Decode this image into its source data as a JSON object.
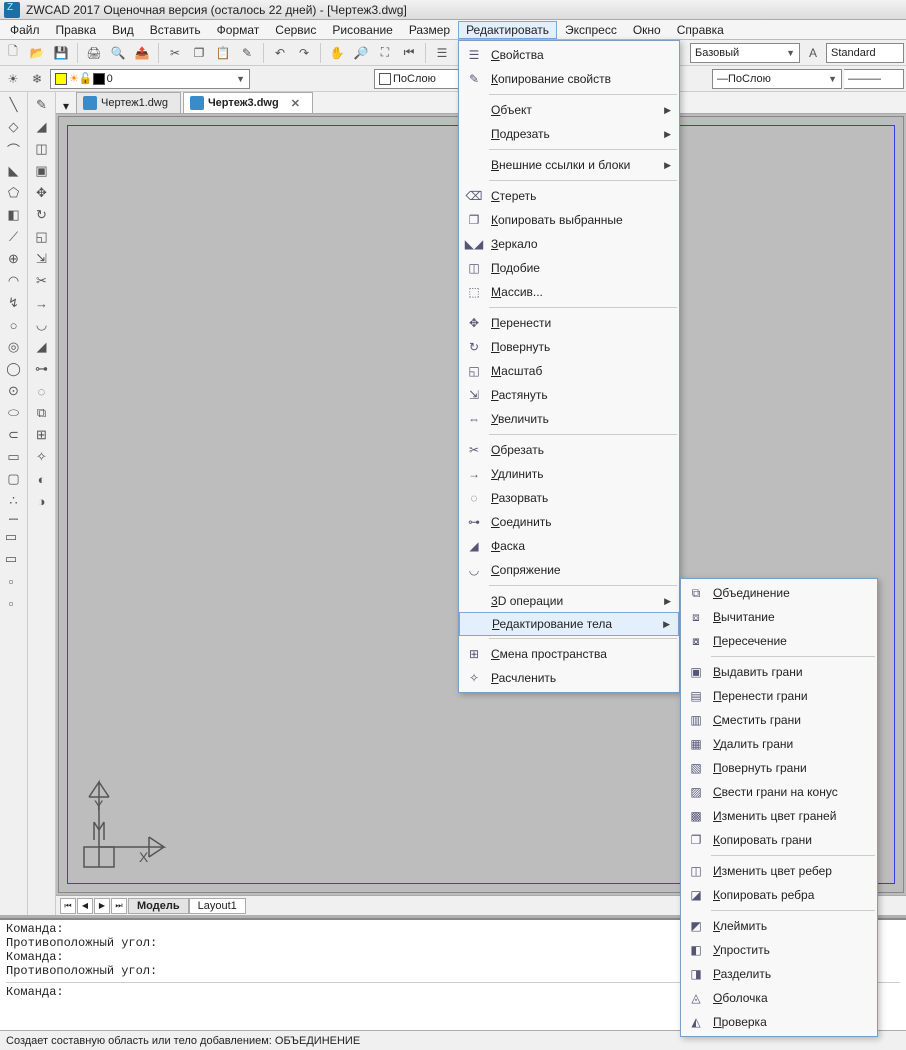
{
  "title": "ZWCAD 2017 Оценочная версия (осталось 22 дней) - [Чертеж3.dwg]",
  "menubar": [
    "Файл",
    "Правка",
    "Вид",
    "Вставить",
    "Формат",
    "Сервис",
    "Рисование",
    "Размер",
    "Редактировать",
    "Экспресс",
    "Окно",
    "Справка"
  ],
  "active_menu_index": 8,
  "layer_combo_prefix": "layer-state",
  "layer_value": "0",
  "bylayer1": "ПоСлою",
  "bylayer2": "ПоСлою",
  "base_style": "Базовый",
  "standard_style": "Standard",
  "doctabs": [
    {
      "label": "Чертеж1.dwg",
      "active": false
    },
    {
      "label": "Чертеж3.dwg",
      "active": true
    }
  ],
  "model_tabs": {
    "model": "Модель",
    "layout": "Layout1"
  },
  "cmd": {
    "l1": "Команда:",
    "l2": "Противоположный угол:",
    "l3": "Команда:",
    "l4": "Противоположный угол:",
    "prompt": "Команда:"
  },
  "status": "Создает составную область или тело добавлением:  ОБЪЕДИНЕНИЕ",
  "edit_menu": [
    {
      "t": "item",
      "label": "Свойства",
      "icon": "☰"
    },
    {
      "t": "item",
      "label": "Копирование свойств",
      "icon": "✎"
    },
    {
      "t": "sep"
    },
    {
      "t": "sub",
      "label": "Объект"
    },
    {
      "t": "sub",
      "label": "Подрезать"
    },
    {
      "t": "sep"
    },
    {
      "t": "sub",
      "label": "Внешние ссылки и блоки"
    },
    {
      "t": "sep"
    },
    {
      "t": "item",
      "label": "Стереть",
      "icon": "⌫"
    },
    {
      "t": "item",
      "label": "Копировать выбранные",
      "icon": "❐"
    },
    {
      "t": "item",
      "label": "Зеркало",
      "icon": "◣◢"
    },
    {
      "t": "item",
      "label": "Подобие",
      "icon": "◫"
    },
    {
      "t": "item",
      "label": "Массив...",
      "icon": "⬚"
    },
    {
      "t": "sep"
    },
    {
      "t": "item",
      "label": "Перенести",
      "icon": "✥"
    },
    {
      "t": "item",
      "label": "Повернуть",
      "icon": "↻"
    },
    {
      "t": "item",
      "label": "Масштаб",
      "icon": "◱"
    },
    {
      "t": "item",
      "label": "Растянуть",
      "icon": "⇲"
    },
    {
      "t": "item",
      "label": "Увеличить",
      "icon": "⇔"
    },
    {
      "t": "sep"
    },
    {
      "t": "item",
      "label": "Обрезать",
      "icon": "✂"
    },
    {
      "t": "item",
      "label": "Удлинить",
      "icon": "→"
    },
    {
      "t": "item",
      "label": "Разорвать",
      "icon": "◌"
    },
    {
      "t": "item",
      "label": "Соединить",
      "icon": "⊶"
    },
    {
      "t": "item",
      "label": "Фаска",
      "icon": "◢"
    },
    {
      "t": "item",
      "label": "Сопряжение",
      "icon": "◡"
    },
    {
      "t": "sep"
    },
    {
      "t": "sub",
      "label": "3D операции"
    },
    {
      "t": "sub",
      "label": "Редактирование тела",
      "hover": true
    },
    {
      "t": "sep"
    },
    {
      "t": "item",
      "label": "Смена пространства",
      "icon": "⊞"
    },
    {
      "t": "item",
      "label": "Расчленить",
      "icon": "✧"
    }
  ],
  "solid_submenu": [
    {
      "t": "item",
      "label": "Объединение",
      "icon": "⧉"
    },
    {
      "t": "item",
      "label": "Вычитание",
      "icon": "⧈"
    },
    {
      "t": "item",
      "label": "Пересечение",
      "icon": "⧇"
    },
    {
      "t": "sep"
    },
    {
      "t": "item",
      "label": "Выдавить грани",
      "icon": "▣"
    },
    {
      "t": "item",
      "label": "Перенести грани",
      "icon": "▤"
    },
    {
      "t": "item",
      "label": "Сместить грани",
      "icon": "▥"
    },
    {
      "t": "item",
      "label": "Удалить грани",
      "icon": "▦"
    },
    {
      "t": "item",
      "label": "Повернуть грани",
      "icon": "▧"
    },
    {
      "t": "item",
      "label": "Свести грани на конус",
      "icon": "▨"
    },
    {
      "t": "item",
      "label": "Изменить цвет граней",
      "icon": "▩"
    },
    {
      "t": "item",
      "label": "Копировать грани",
      "icon": "❐"
    },
    {
      "t": "sep"
    },
    {
      "t": "item",
      "label": "Изменить цвет ребер",
      "icon": "◫"
    },
    {
      "t": "item",
      "label": "Копировать ребра",
      "icon": "◪"
    },
    {
      "t": "sep"
    },
    {
      "t": "item",
      "label": "Клеймить",
      "icon": "◩"
    },
    {
      "t": "item",
      "label": "Упростить",
      "icon": "◧"
    },
    {
      "t": "item",
      "label": "Разделить",
      "icon": "◨"
    },
    {
      "t": "item",
      "label": "Оболочка",
      "icon": "◬"
    },
    {
      "t": "item",
      "label": "Проверка",
      "icon": "◭"
    }
  ]
}
